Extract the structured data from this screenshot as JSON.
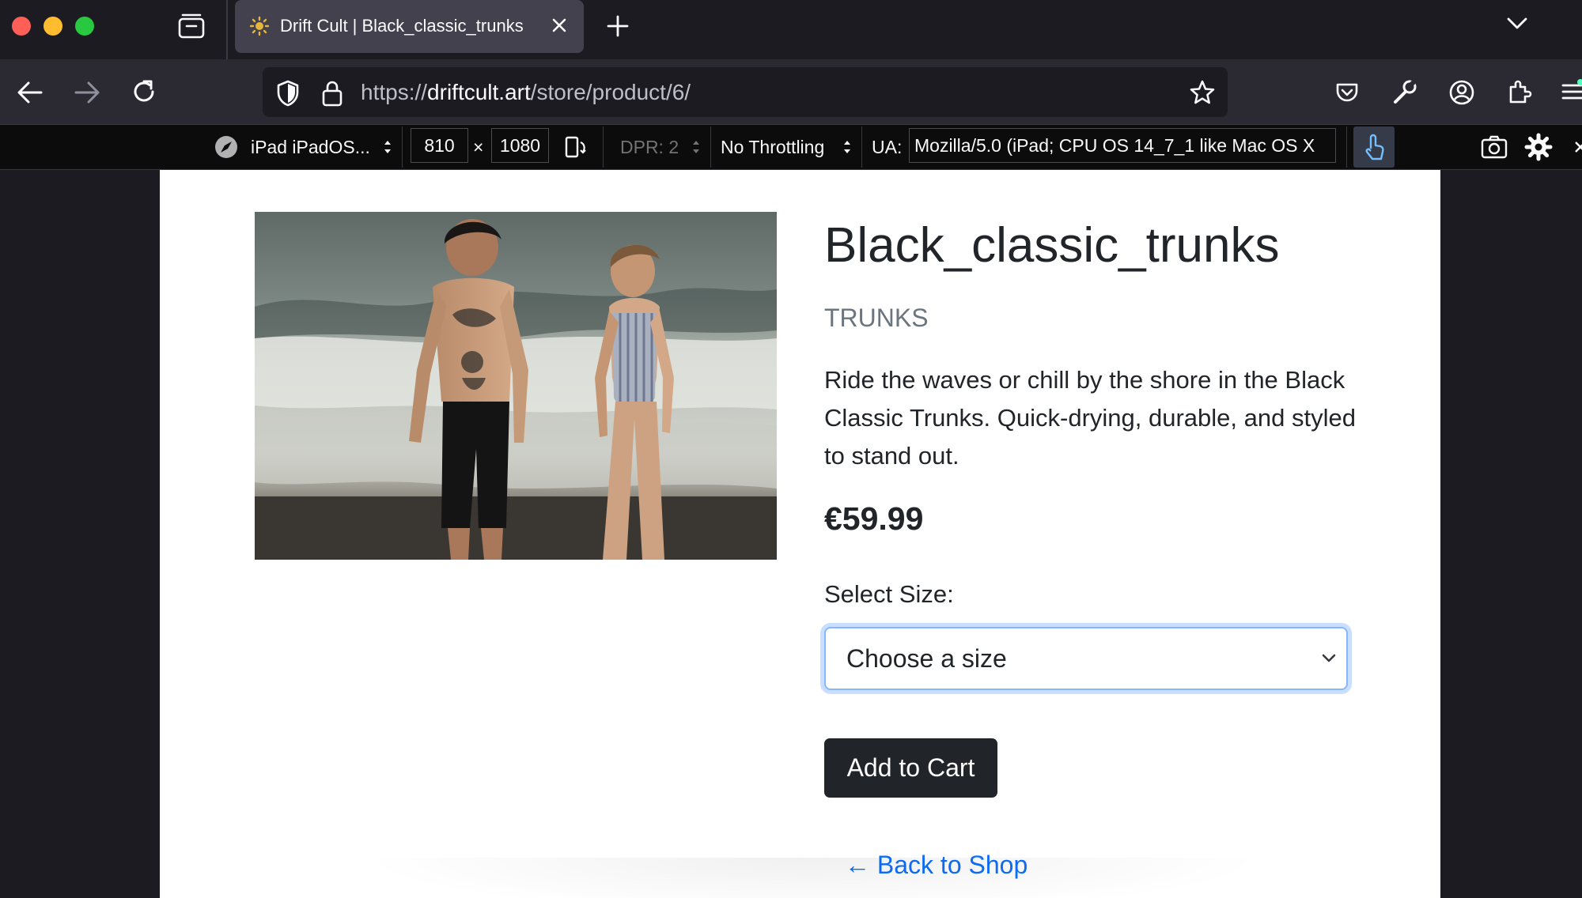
{
  "browser": {
    "tab_title": "Drift Cult | Black_classic_trunks",
    "url": {
      "scheme": "https://",
      "host": "driftcult.art",
      "path": "/store/product/6/"
    }
  },
  "devtools": {
    "device": "iPad iPadOS...",
    "width": "810",
    "times": "×",
    "height": "1080",
    "dpr": "DPR: 2",
    "throttling": "No Throttling",
    "ua_label": "UA:",
    "ua_value": "Mozilla/5.0 (iPad; CPU OS 14_7_1 like Mac OS X"
  },
  "product": {
    "title": "Black_classic_trunks",
    "category": "TRUNKS",
    "description": "Ride the waves or chill by the shore in the Black Classic Trunks. Quick-drying, durable, and styled to stand out.",
    "price": "€59.99",
    "size_label": "Select Size:",
    "size_placeholder": "Choose a size",
    "add_to_cart": "Add to Cart",
    "back_link": "← Back to Shop"
  },
  "colors": {
    "primary_link": "#0d6efd",
    "dark_button": "#212529",
    "muted_text": "#6c757d",
    "focus_ring": "#86b7fe"
  },
  "icons": [
    "traffic-lights",
    "tab-overview-icon",
    "favicon-sun-icon",
    "close-tab-icon",
    "new-tab-icon",
    "tab-list-icon",
    "back-icon",
    "forward-icon",
    "reload-icon",
    "shield-icon",
    "lock-icon",
    "star-icon",
    "pocket-icon",
    "wrench-icon",
    "account-icon",
    "extensions-icon",
    "menu-icon",
    "compass-icon",
    "rotate-icon",
    "touch-icon",
    "screenshot-icon",
    "settings-icon",
    "chevron-down-icon"
  ]
}
